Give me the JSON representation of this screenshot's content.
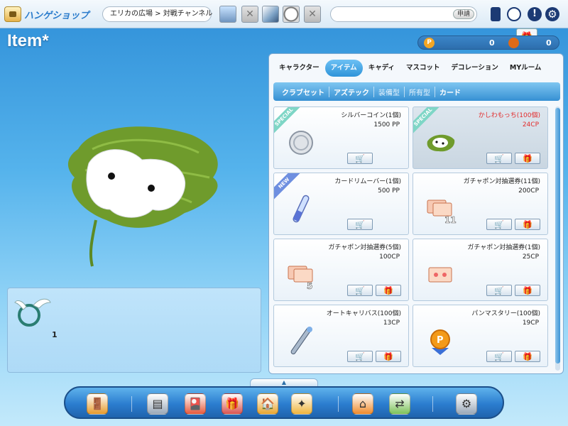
{
  "header": {
    "logo_text": "ハンゲショップ",
    "location": "エリカの広場 > 対戦チャンネル",
    "request_button": "申請",
    "icons": [
      "phone-icon",
      "profile-search-icon",
      "alert-icon",
      "gear-icon",
      "gift-icon"
    ]
  },
  "page": {
    "title": "Item*"
  },
  "wallet": {
    "pp_label": "P",
    "pp_value": "0",
    "cp_value": "0"
  },
  "inventory": {
    "slots": [
      {
        "icon": "winged-ring-icon",
        "count": "1"
      }
    ]
  },
  "shop": {
    "tabs": [
      {
        "label": "キャラクター",
        "active": false
      },
      {
        "label": "アイテム",
        "active": true
      },
      {
        "label": "キャディ",
        "active": false
      },
      {
        "label": "マスコット",
        "active": false
      },
      {
        "label": "デコレーション",
        "active": false
      },
      {
        "label": "MYルーム",
        "active": false
      }
    ],
    "subtabs": [
      {
        "label": "クラブセット",
        "dim": false
      },
      {
        "label": "アズテック",
        "dim": false
      },
      {
        "label": "装備型",
        "dim": true
      },
      {
        "label": "所有型",
        "dim": true
      },
      {
        "label": "カード",
        "dim": false
      }
    ],
    "items": [
      {
        "name": "シルバーコイン(1個)",
        "price": "1500 PP",
        "ribbon": "SPECIAL",
        "icon": "silver-coin-icon",
        "gift": false,
        "selected": false,
        "red": false
      },
      {
        "name": "かしわもっち(100個)",
        "price": "24CP",
        "ribbon": "SPECIAL",
        "icon": "kashiwa-mochi-icon",
        "gift": true,
        "selected": true,
        "red": true
      },
      {
        "name": "カードリムーバー(1個)",
        "price": "500 PP",
        "ribbon": "NEW",
        "icon": "card-remover-icon",
        "gift": false,
        "selected": false,
        "red": false
      },
      {
        "name": "ガチャポン対抽選券(11個)",
        "price": "200CP",
        "ribbon": "",
        "icon": "gacha-ticket-11-icon",
        "gift": true,
        "selected": false,
        "red": false
      },
      {
        "name": "ガチャポン対抽選券(5個)",
        "price": "100CP",
        "ribbon": "",
        "icon": "gacha-ticket-5-icon",
        "gift": true,
        "selected": false,
        "red": false
      },
      {
        "name": "ガチャポン対抽選券(1個)",
        "price": "25CP",
        "ribbon": "",
        "icon": "gacha-ticket-icon",
        "gift": true,
        "selected": false,
        "red": false
      },
      {
        "name": "オートキャリバス(100個)",
        "price": "13CP",
        "ribbon": "",
        "icon": "auto-caliper-icon",
        "gift": true,
        "selected": false,
        "red": false
      },
      {
        "name": "パンマスタリー(100個)",
        "price": "19CP",
        "ribbon": "",
        "icon": "pang-mastery-icon",
        "gift": true,
        "selected": false,
        "red": false
      }
    ]
  },
  "dock": {
    "handle": "▲",
    "icons": [
      "exit-door-icon",
      "cash-register-icon",
      "gift-card-icon",
      "gift-box-icon",
      "shop-icon",
      "coupon-icon",
      "home-icon",
      "exchange-icon",
      "settings-plug-icon"
    ]
  }
}
